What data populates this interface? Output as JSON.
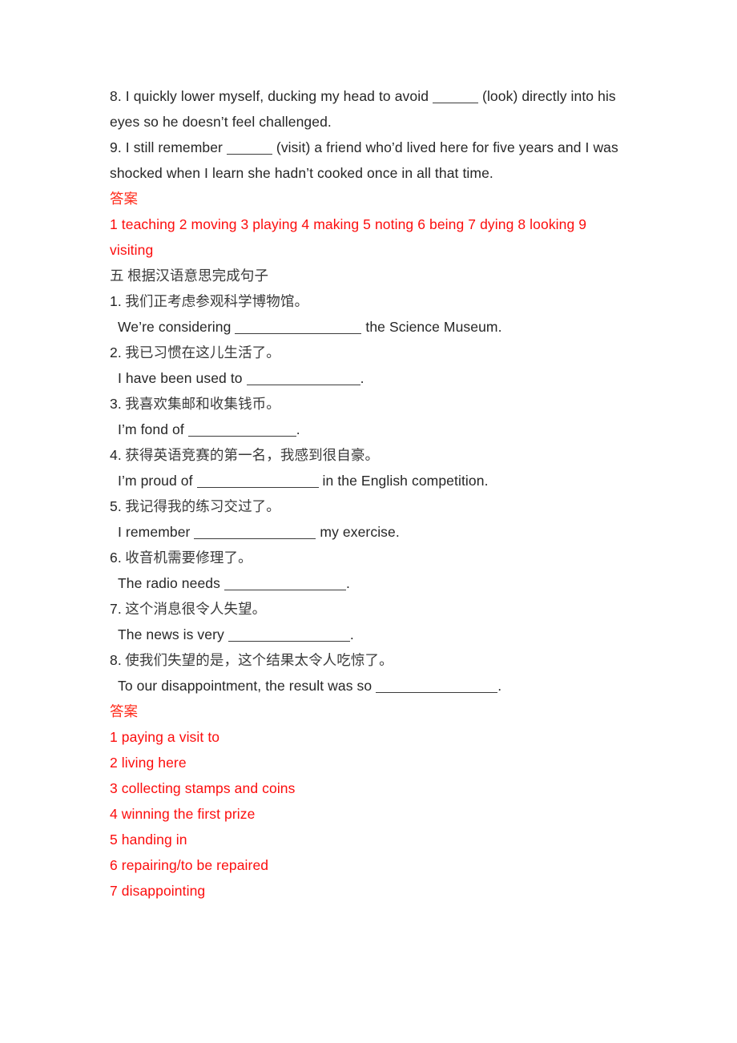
{
  "document": {
    "type": "worksheet-answer-key",
    "language": "zh-CN/en",
    "accent_color": "#fc0d0d",
    "text_color": "#262626",
    "background_color": "#ffffff"
  },
  "section_top": {
    "items": [
      {
        "number": "8.",
        "before": "I quickly lower myself, ducking my head to avoid",
        "blank": "______",
        "after": "(look) directly into his eyes so he doesn’t feel challenged."
      },
      {
        "number": "9.",
        "before": "I still remember",
        "blank": "______",
        "after": "(visit) a friend who’d lived here for five years and I was shocked when I learn she hadn’t cooked once in all that time."
      }
    ],
    "answer_heading": "答案",
    "answer_text": "1 teaching 2 moving 3 playing 4 making 5 noting 6 being 7 dying 8 looking 9 visiting"
  },
  "section_five": {
    "heading": "五 根据汉语意思完成句子",
    "items": [
      {
        "number": "1.",
        "chinese": "我们正考虑参观科学博物馆。",
        "english_before": "We’re considering",
        "english_after": "the Science Museum."
      },
      {
        "number": "2.",
        "chinese": "我已习惯在这儿生活了。",
        "english_before": "I have been used to",
        "english_after": "."
      },
      {
        "number": "3.",
        "chinese": "我喜欢集邮和收集钱币。",
        "english_before": "I’m fond of",
        "english_after": "."
      },
      {
        "number": "4.",
        "chinese": "获得英语竞赛的第一名，我感到很自豪。",
        "english_before": "I’m proud of",
        "english_after": "in the English competition."
      },
      {
        "number": "5.",
        "chinese": "我记得我的练习交过了。",
        "english_before": "I remember",
        "english_after": "my exercise."
      },
      {
        "number": "6.",
        "chinese": "收音机需要修理了。",
        "english_before": "The radio needs",
        "english_after": "."
      },
      {
        "number": "7.",
        "chinese": "这个消息很令人失望。",
        "english_before": "The news is very",
        "english_after": "."
      },
      {
        "number": "8.",
        "chinese": "使我们失望的是，这个结果太令人吃惊了。",
        "english_before": "To our disappointment, the result was so",
        "english_after": "."
      }
    ],
    "answer_heading": "答案",
    "answers": [
      "1 paying a visit to",
      "2 living here",
      "3 collecting stamps and coins",
      "4 winning the first prize",
      "5 handing in",
      "6 repairing/to be repaired",
      "7 disappointing"
    ]
  }
}
